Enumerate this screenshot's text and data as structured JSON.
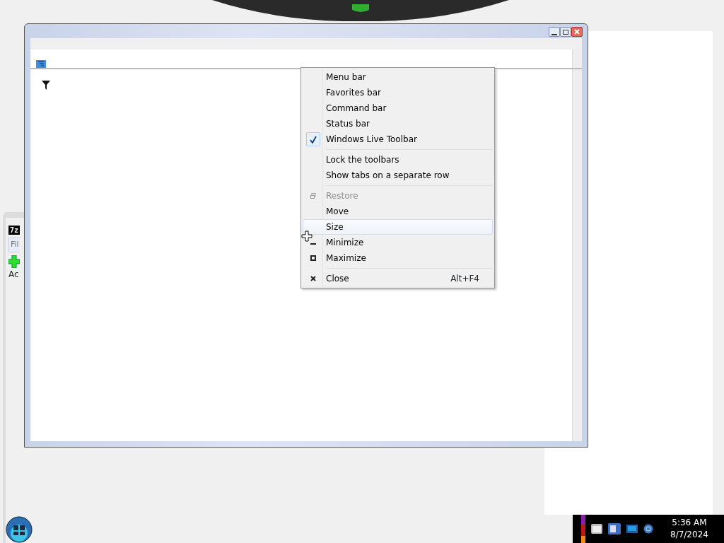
{
  "back_window": {
    "logo": "7z",
    "menu": [
      "Fil"
    ],
    "toolbar": [
      {
        "label": "Ac"
      }
    ]
  },
  "context_menu": {
    "items": [
      {
        "kind": "item",
        "label": "Menu bar",
        "checked": false,
        "disabled": false,
        "selected": false
      },
      {
        "kind": "item",
        "label": "Favorites bar",
        "checked": false,
        "disabled": false,
        "selected": false
      },
      {
        "kind": "item",
        "label": "Command bar",
        "checked": false,
        "disabled": false,
        "selected": false
      },
      {
        "kind": "item",
        "label": "Status bar",
        "checked": false,
        "disabled": false,
        "selected": false
      },
      {
        "kind": "item",
        "label": "Windows Live Toolbar",
        "checked": true,
        "disabled": false,
        "selected": false
      },
      {
        "kind": "separator"
      },
      {
        "kind": "item",
        "label": "Lock the toolbars",
        "checked": false,
        "disabled": false,
        "selected": false
      },
      {
        "kind": "item",
        "label": "Show tabs on a separate row",
        "checked": false,
        "disabled": false,
        "selected": false
      },
      {
        "kind": "separator"
      },
      {
        "kind": "restore",
        "label": "Restore",
        "checked": false,
        "disabled": true,
        "selected": false
      },
      {
        "kind": "item",
        "label": "Move",
        "checked": false,
        "disabled": false,
        "selected": false
      },
      {
        "kind": "item",
        "label": "Size",
        "checked": false,
        "disabled": false,
        "selected": true
      },
      {
        "kind": "minimize",
        "label": "Minimize",
        "checked": false,
        "disabled": false,
        "selected": false
      },
      {
        "kind": "maximize",
        "label": "Maximize",
        "checked": false,
        "disabled": false,
        "selected": false
      },
      {
        "kind": "separator"
      },
      {
        "kind": "close",
        "label": "Close",
        "shortcut": "Alt+F4",
        "checked": false,
        "disabled": false,
        "selected": false
      }
    ]
  },
  "taskbar": {
    "time": "5:36 AM",
    "date": "8/7/2024"
  }
}
